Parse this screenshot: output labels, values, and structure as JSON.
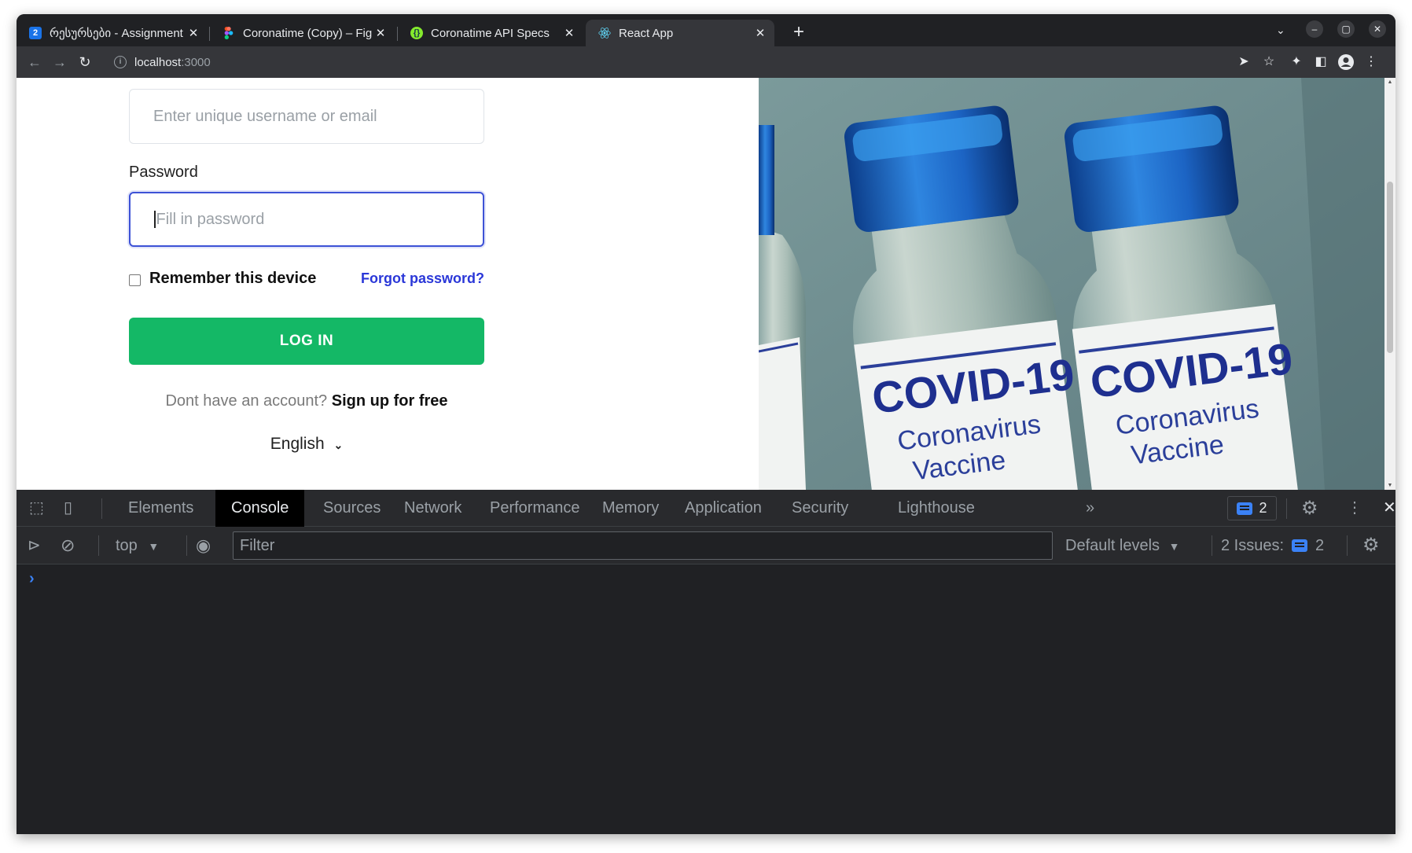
{
  "browser": {
    "tabs": [
      {
        "title": "რესურსები - Assignment",
        "favicon_text": "2",
        "favicon_color": "#1a73e8"
      },
      {
        "title": "Coronatime (Copy) – Figma",
        "favicon_text": "",
        "favicon_color": "#f24e1e"
      },
      {
        "title": "Coronatime API Specs",
        "favicon_text": "",
        "favicon_color": "#85ea2d"
      },
      {
        "title": "React App",
        "favicon_text": "",
        "favicon_color": "#61dafb"
      }
    ],
    "active_tab": 3,
    "url_host": "localhost",
    "url_port": ":3000"
  },
  "page": {
    "username_placeholder": "Enter unique username or email",
    "password_label": "Password",
    "password_placeholder": "Fill in password",
    "remember_label": "Remember this device",
    "forgot_label": "Forgot password?",
    "login_label": "LOG IN",
    "signup_prompt": "Dont have an account?",
    "signup_link": "Sign up for free",
    "language": "English",
    "hero_image": {
      "vial_label_1": "COVID-19",
      "vial_sub_1a": "Coronavirus",
      "vial_sub_1b": "Vaccine",
      "vial_label_2": "COVID-19",
      "vial_sub_2a": "Coronavirus",
      "vial_sub_2b": "Vaccine"
    }
  },
  "devtools": {
    "tabs": [
      "Elements",
      "Console",
      "Sources",
      "Network",
      "Performance",
      "Memory",
      "Application",
      "Security",
      "Lighthouse"
    ],
    "active_tab": "Console",
    "issues_count": "2",
    "context": "top",
    "filter_placeholder": "Filter",
    "levels": "Default levels",
    "issues_label": "2 Issues:",
    "issues_bar_count": "2"
  },
  "colors": {
    "primary_green": "#14b866",
    "link_blue": "#2a37d8",
    "focus_blue": "#3d52d6"
  }
}
